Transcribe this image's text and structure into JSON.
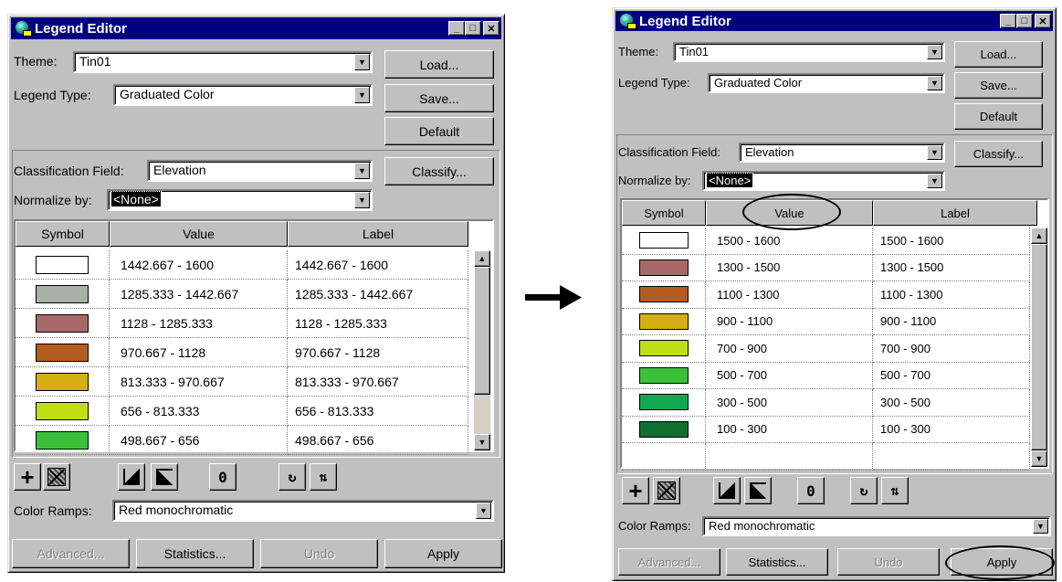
{
  "left": {
    "title": "Legend Editor",
    "theme_label": "Theme:",
    "theme_value": "Tin01",
    "legend_type_label": "Legend Type:",
    "legend_type_value": "Graduated Color",
    "load_label": "Load...",
    "save_label": "Save...",
    "default_label": "Default",
    "classification_field_label": "Classification Field:",
    "classification_field_value": "Elevation",
    "classify_label": "Classify...",
    "normalize_label": "Normalize by:",
    "normalize_value": "<None>",
    "columns": [
      "Symbol",
      "Value",
      "Label"
    ],
    "rows": [
      {
        "color": "#ffffff",
        "value": "1442.667 - 1600",
        "label": "1442.667 - 1600"
      },
      {
        "color": "#a8b0a8",
        "value": "1285.333 - 1442.667",
        "label": "1285.333 - 1442.667"
      },
      {
        "color": "#a86868",
        "value": "1128 - 1285.333",
        "label": "1128 - 1285.333"
      },
      {
        "color": "#b35c20",
        "value": "970.667 - 1128",
        "label": "970.667 - 1128"
      },
      {
        "color": "#d4b012",
        "value": "813.333 - 970.667",
        "label": "813.333 - 970.667"
      },
      {
        "color": "#c0de14",
        "value": "656 - 813.333",
        "label": "656 - 813.333"
      },
      {
        "color": "#3cc03c",
        "value": "498.667 - 656",
        "label": "498.667 - 656"
      }
    ],
    "color_ramps_label": "Color Ramps:",
    "color_ramps_value": "Red monochromatic",
    "advanced_label": "Advanced...",
    "statistics_label": "Statistics...",
    "undo_label": "Undo",
    "apply_label": "Apply"
  },
  "right": {
    "title": "Legend Editor",
    "theme_label": "Theme:",
    "theme_value": "Tin01",
    "legend_type_label": "Legend Type:",
    "legend_type_value": "Graduated Color",
    "load_label": "Load...",
    "save_label": "Save...",
    "default_label": "Default",
    "classification_field_label": "Classification Field:",
    "classification_field_value": "Elevation",
    "classify_label": "Classify...",
    "normalize_label": "Normalize by:",
    "normalize_value": "<None>",
    "columns": [
      "Symbol",
      "Value",
      "Label"
    ],
    "rows": [
      {
        "color": "#ffffff",
        "value": "1500 - 1600",
        "label": "1500 - 1600"
      },
      {
        "color": "#a86868",
        "value": "1300 - 1500",
        "label": "1300 - 1500"
      },
      {
        "color": "#b35c20",
        "value": "1100 - 1300",
        "label": "1100 - 1300"
      },
      {
        "color": "#d4b012",
        "value": "900 - 1100",
        "label": "900 - 1100"
      },
      {
        "color": "#c0de14",
        "value": "700 - 900",
        "label": "700 - 900"
      },
      {
        "color": "#3cc03c",
        "value": "500 - 700",
        "label": "500 - 700"
      },
      {
        "color": "#10a850",
        "value": "300 - 500",
        "label": "300 - 500"
      },
      {
        "color": "#107030",
        "value": "100 - 300",
        "label": "100 - 300"
      }
    ],
    "color_ramps_label": "Color Ramps:",
    "color_ramps_value": "Red monochromatic",
    "advanced_label": "Advanced...",
    "statistics_label": "Statistics...",
    "undo_label": "Undo",
    "apply_label": "Apply"
  },
  "icons": {
    "title": "legend-editor-globe-icon",
    "minimize": "minimize-icon",
    "maximize": "maximize-icon",
    "close": "close-icon",
    "dropdown": "chevron-down-icon",
    "transition": "right-arrow-icon"
  },
  "colors": {
    "titlebar": "#000080",
    "face": "#c0c0c0"
  }
}
